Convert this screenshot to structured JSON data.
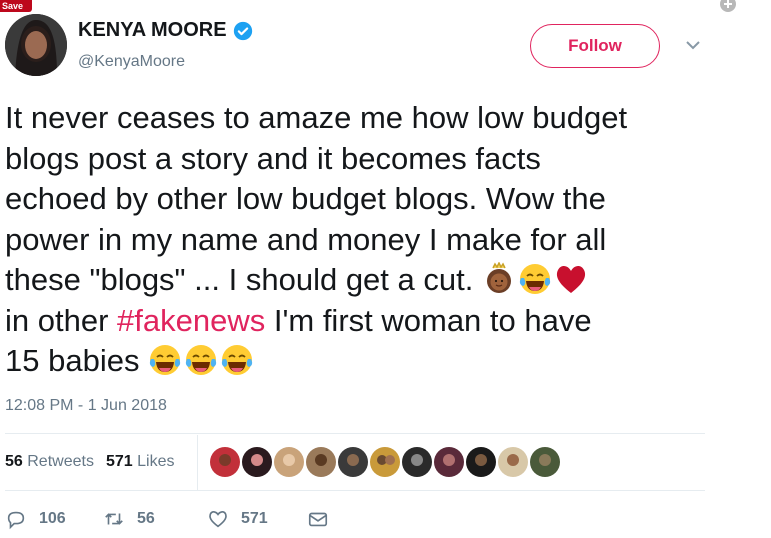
{
  "save_badge": "Save",
  "user": {
    "display_name": "KENYA MOORE",
    "handle": "@KenyaMoore",
    "verified": true
  },
  "follow_label": "Follow",
  "tweet": {
    "line1": "It never ceases to amaze me how low budget",
    "line2": "blogs post a story and it becomes facts",
    "line3": "echoed by other low budget blogs.  Wow the",
    "line4": "power in my name and money I make for all",
    "line5": "these \"blogs\" ... I should get a cut.",
    "line6_pre": "in other ",
    "hashtag": "#fakenews",
    "line6_post": "  I'm first woman to have",
    "line7": "15 babies"
  },
  "timestamp": "12:08 PM - 1 Jun 2018",
  "stats": {
    "retweets_count": "56",
    "retweets_label": "Retweets",
    "likes_count": "571",
    "likes_label": "Likes"
  },
  "actions": {
    "reply_count": "106",
    "retweet_count": "56",
    "like_count": "571"
  },
  "colors": {
    "accent": "#e0245e",
    "secondary_text": "#657786",
    "verified_blue": "#1da1f2"
  }
}
